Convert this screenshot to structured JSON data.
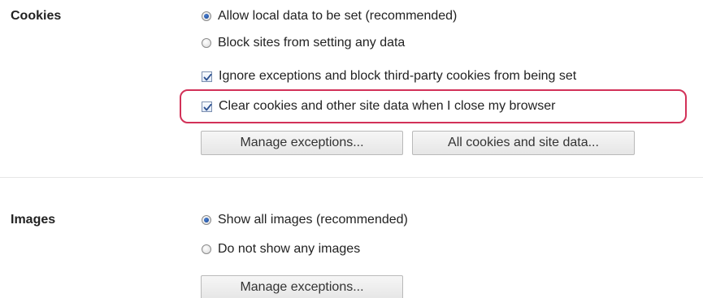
{
  "cookies": {
    "title": "Cookies",
    "options": [
      {
        "type": "radio",
        "checked": true,
        "label": "Allow local data to be set (recommended)"
      },
      {
        "type": "radio",
        "checked": false,
        "label": "Block sites from setting any data"
      },
      {
        "type": "checkbox",
        "checked": true,
        "label": "Ignore exceptions and block third-party cookies from being set"
      },
      {
        "type": "checkbox",
        "checked": true,
        "label": "Clear cookies and other site data when I close my browser"
      }
    ],
    "buttons": {
      "manage_exceptions": "Manage exceptions...",
      "all_cookies": "All cookies and site data..."
    },
    "highlight_color": "#d23158"
  },
  "images": {
    "title": "Images",
    "options": [
      {
        "type": "radio",
        "checked": true,
        "label": "Show all images (recommended)"
      },
      {
        "type": "radio",
        "checked": false,
        "label": "Do not show any images"
      }
    ],
    "buttons": {
      "manage_exceptions": "Manage exceptions..."
    }
  }
}
